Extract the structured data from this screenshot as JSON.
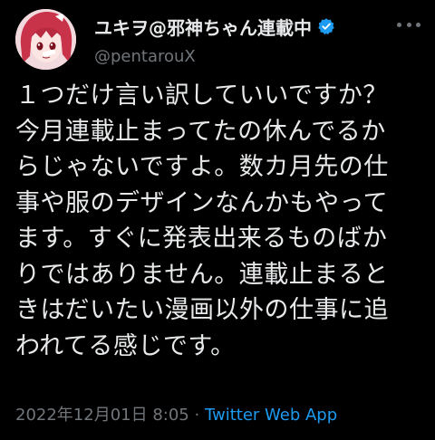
{
  "author": {
    "display_name": "ユキヲ@邪神ちゃん連載中",
    "handle": "@pentarouX",
    "verified_icon": "verified-badge-icon",
    "avatar": "avatar-icon"
  },
  "tweet": {
    "lines": [
      "１つだけ言い訳していいですか？",
      "今月連載止まってたの休んでるか",
      "らじゃないですよ。数カ月先の仕",
      "事や服のデザインなんかもやって",
      "ます。すぐに発表出来るものばか",
      "りではありません。連載止まると",
      "きはだいたい漫画以外の仕事に追",
      "われてる感じです。"
    ]
  },
  "meta": {
    "timestamp": "2022年12月01日 8:05",
    "separator": "·",
    "source_app": "Twitter Web App"
  },
  "colors": {
    "background": "#000000",
    "text": "#e7e9ea",
    "secondary": "#71767b",
    "accent": "#1d9bf0"
  }
}
